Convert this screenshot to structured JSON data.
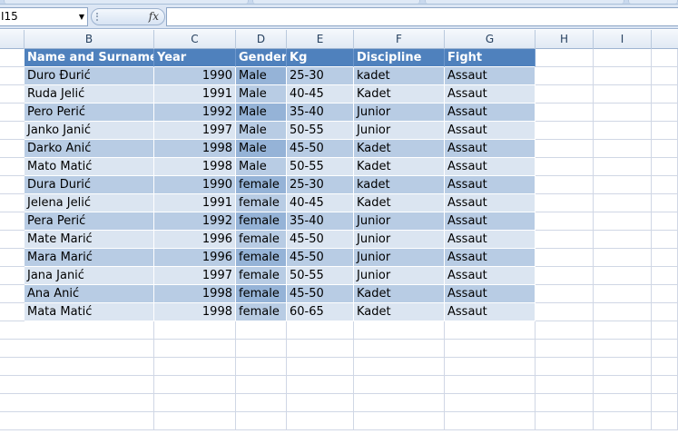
{
  "formula_bar": {
    "name_box": "I15",
    "fx_label": "fx",
    "formula": ""
  },
  "columns": [
    "B",
    "C",
    "D",
    "E",
    "F",
    "G",
    "H",
    "I"
  ],
  "table": {
    "headers": [
      "Name and Surname",
      "Year",
      "Genderl",
      "Kg",
      "Discipline",
      "Fight"
    ],
    "rows": [
      [
        "Duro Đurić",
        "1990",
        "Male",
        "25-30",
        "kadet",
        "Assaut"
      ],
      [
        "Ruda Jelić",
        "1991",
        "Male",
        "40-45",
        "Kadet",
        "Assaut"
      ],
      [
        "Pero Perić",
        "1992",
        "Male",
        "35-40",
        "Junior",
        "Assaut"
      ],
      [
        "Janko Janić",
        "1997",
        "Male",
        "50-55",
        "Junior",
        "Assaut"
      ],
      [
        "Darko Anić",
        "1998",
        "Male",
        "45-50",
        "Kadet",
        "Assaut"
      ],
      [
        "Mato Matić",
        "1998",
        "Male",
        "50-55",
        "Kadet",
        "Assaut"
      ],
      [
        "Dura Durić",
        "1990",
        "female",
        "25-30",
        "kadet",
        "Assaut"
      ],
      [
        "Jelena Jelić",
        "1991",
        "female",
        "40-45",
        "Kadet",
        "Assaut"
      ],
      [
        "Pera Perić",
        "1992",
        "female",
        "35-40",
        "Junior",
        "Assaut"
      ],
      [
        "Mate Marić",
        "1996",
        "female",
        "45-50",
        "Junior",
        "Assaut"
      ],
      [
        "Mara Marić",
        "1996",
        "female",
        "45-50",
        "Junior",
        "Assaut"
      ],
      [
        "Jana Janić",
        "1997",
        "female",
        "50-55",
        "Junior",
        "Assaut"
      ],
      [
        "Ana Anić",
        "1998",
        "female",
        "45-50",
        "Kadet",
        "Assaut"
      ],
      [
        "Mata Matić",
        "1998",
        "female",
        "60-65",
        "Kadet",
        "Assaut"
      ]
    ]
  },
  "colors": {
    "table_header": "#4f81bd",
    "band_dark": "#b8cce4",
    "band_light": "#dbe5f1"
  }
}
